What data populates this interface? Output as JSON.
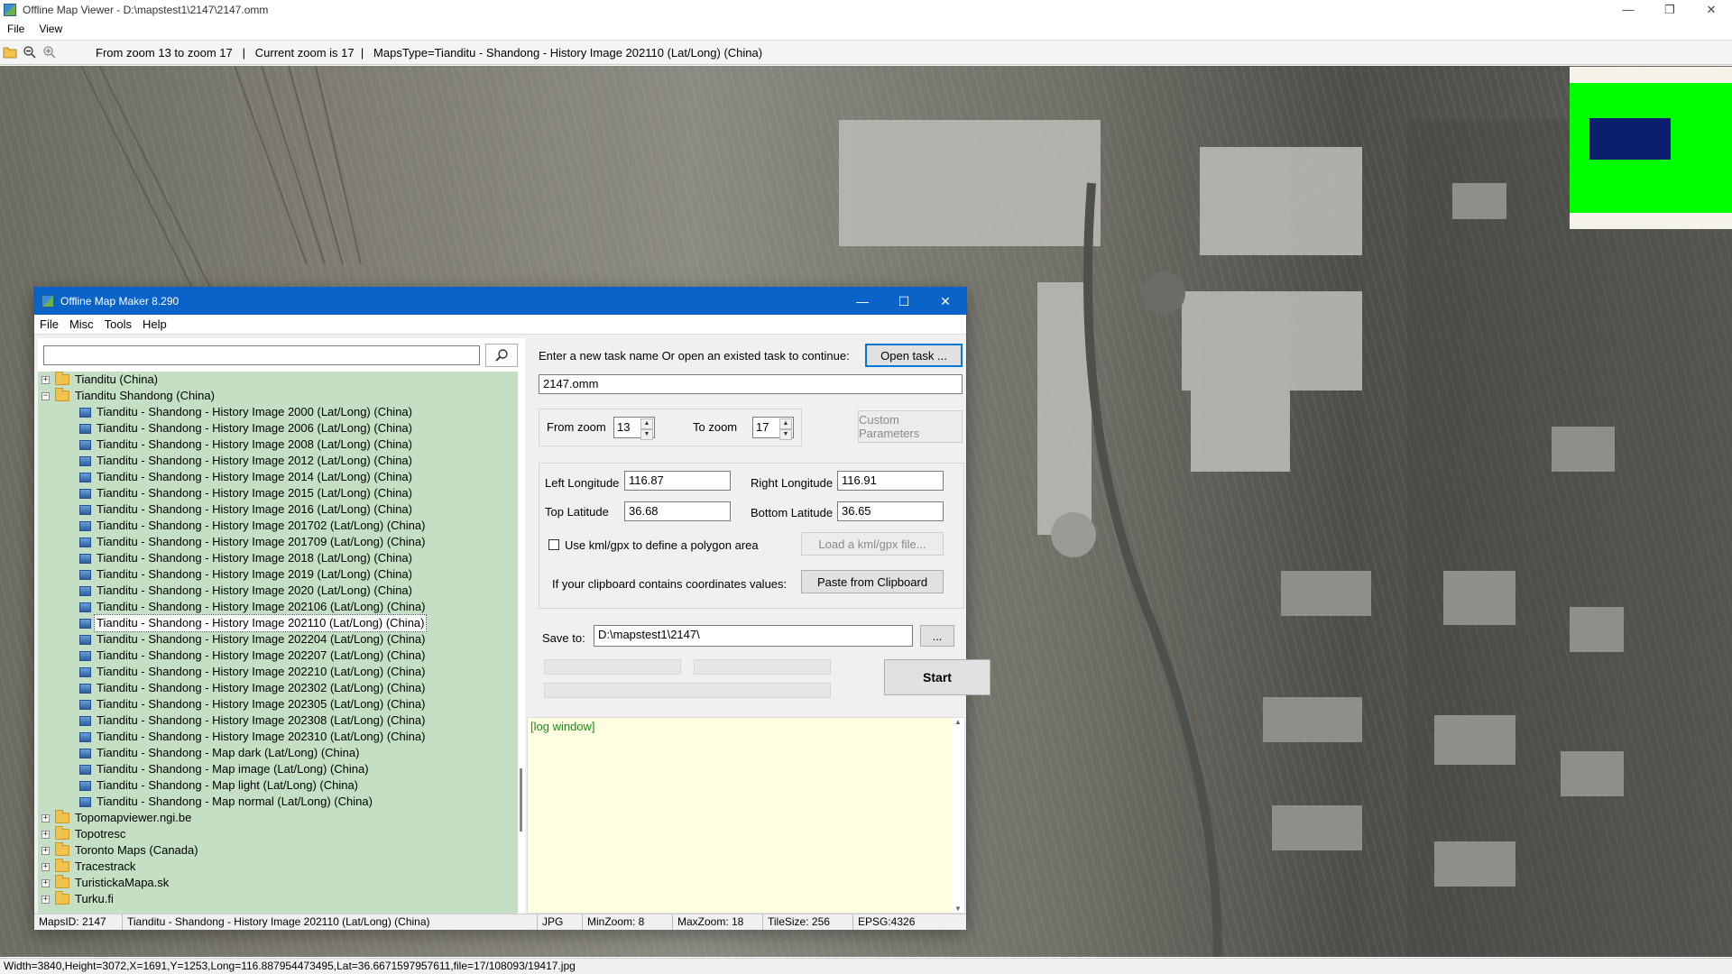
{
  "viewer": {
    "title": "Offline Map Viewer - D:\\mapstest1\\2147\\2147.omm",
    "menu": [
      "File",
      "View"
    ],
    "toolbar_status": "From zoom 13 to zoom 17   |   Current zoom is 17  |   MapsType=Tianditu - Shandong - History Image 202110 (Lat/Long) (China)",
    "status": "Width=3840,Height=3072,X=1691,Y=1253,Long=116.887954473495,Lat=36.6671597957611,file=17/108093/19417.jpg",
    "controls": {
      "minimize": "—",
      "maximize": "❐",
      "close": "✕"
    },
    "icons": {
      "open": "folder-open-icon",
      "zoom_out": "zoom-out-icon",
      "zoom_in": "zoom-in-icon"
    },
    "minimap_colors": {
      "background": "#00ff00",
      "viewport": "#0a1f6e"
    }
  },
  "dialog": {
    "title": "Offline Map Maker 8.290",
    "menu": [
      "File",
      "Misc",
      "Tools",
      "Help"
    ],
    "controls": {
      "minimize": "—",
      "maximize": "☐",
      "close": "✕"
    },
    "search": {
      "value": "",
      "placeholder": ""
    },
    "tree": [
      {
        "level": 0,
        "type": "folder",
        "expanded": false,
        "label": "Tianditu (China)"
      },
      {
        "level": 0,
        "type": "folder",
        "expanded": true,
        "label": "Tianditu Shandong (China)"
      },
      {
        "level": 1,
        "type": "map",
        "label": "Tianditu - Shandong - History Image 2000 (Lat/Long) (China)"
      },
      {
        "level": 1,
        "type": "map",
        "label": "Tianditu - Shandong - History Image 2006 (Lat/Long) (China)"
      },
      {
        "level": 1,
        "type": "map",
        "label": "Tianditu - Shandong - History Image 2008 (Lat/Long) (China)"
      },
      {
        "level": 1,
        "type": "map",
        "label": "Tianditu - Shandong - History Image 2012 (Lat/Long) (China)"
      },
      {
        "level": 1,
        "type": "map",
        "label": "Tianditu - Shandong - History Image 2014 (Lat/Long) (China)"
      },
      {
        "level": 1,
        "type": "map",
        "label": "Tianditu - Shandong - History Image 2015 (Lat/Long) (China)"
      },
      {
        "level": 1,
        "type": "map",
        "label": "Tianditu - Shandong - History Image 2016 (Lat/Long) (China)"
      },
      {
        "level": 1,
        "type": "map",
        "label": "Tianditu - Shandong - History Image 201702 (Lat/Long) (China)"
      },
      {
        "level": 1,
        "type": "map",
        "label": "Tianditu - Shandong - History Image 201709 (Lat/Long) (China)"
      },
      {
        "level": 1,
        "type": "map",
        "label": "Tianditu - Shandong - History Image 2018 (Lat/Long) (China)"
      },
      {
        "level": 1,
        "type": "map",
        "label": "Tianditu - Shandong - History Image 2019 (Lat/Long) (China)"
      },
      {
        "level": 1,
        "type": "map",
        "label": "Tianditu - Shandong - History Image 2020 (Lat/Long) (China)"
      },
      {
        "level": 1,
        "type": "map",
        "label": "Tianditu - Shandong - History Image 202106 (Lat/Long) (China)"
      },
      {
        "level": 1,
        "type": "map",
        "label": "Tianditu - Shandong - History Image 202110 (Lat/Long) (China)",
        "selected": true
      },
      {
        "level": 1,
        "type": "map",
        "label": "Tianditu - Shandong - History Image 202204 (Lat/Long) (China)"
      },
      {
        "level": 1,
        "type": "map",
        "label": "Tianditu - Shandong - History Image 202207 (Lat/Long) (China)"
      },
      {
        "level": 1,
        "type": "map",
        "label": "Tianditu - Shandong - History Image 202210 (Lat/Long) (China)"
      },
      {
        "level": 1,
        "type": "map",
        "label": "Tianditu - Shandong - History Image 202302 (Lat/Long) (China)"
      },
      {
        "level": 1,
        "type": "map",
        "label": "Tianditu - Shandong - History Image 202305 (Lat/Long) (China)"
      },
      {
        "level": 1,
        "type": "map",
        "label": "Tianditu - Shandong - History Image 202308 (Lat/Long) (China)"
      },
      {
        "level": 1,
        "type": "map",
        "label": "Tianditu - Shandong - History Image 202310 (Lat/Long) (China)"
      },
      {
        "level": 1,
        "type": "map",
        "label": "Tianditu - Shandong - Map dark (Lat/Long) (China)"
      },
      {
        "level": 1,
        "type": "map",
        "label": "Tianditu - Shandong - Map image (Lat/Long) (China)"
      },
      {
        "level": 1,
        "type": "map",
        "label": "Tianditu - Shandong - Map light (Lat/Long) (China)"
      },
      {
        "level": 1,
        "type": "map",
        "label": "Tianditu - Shandong - Map normal (Lat/Long) (China)"
      },
      {
        "level": 0,
        "type": "folder",
        "expanded": false,
        "label": "Topomapviewer.ngi.be"
      },
      {
        "level": 0,
        "type": "folder",
        "expanded": false,
        "label": "Topotresc"
      },
      {
        "level": 0,
        "type": "folder",
        "expanded": false,
        "label": "Toronto Maps (Canada)"
      },
      {
        "level": 0,
        "type": "folder",
        "expanded": false,
        "label": "Tracestrack"
      },
      {
        "level": 0,
        "type": "folder",
        "expanded": false,
        "label": "TuristickaMapa.sk"
      },
      {
        "level": 0,
        "type": "folder",
        "expanded": false,
        "label": "Turku.fi"
      }
    ],
    "task": {
      "prompt": "Enter a new task name Or open an existed task to continue:",
      "open_button": "Open task ...",
      "name": "2147.omm"
    },
    "zoom": {
      "from_label": "From zoom",
      "from_value": "13",
      "to_label": "To zoom",
      "to_value": "17",
      "custom_button": "Custom Parameters"
    },
    "coords": {
      "left_lon_label": "Left Longitude",
      "left_lon": "116.87",
      "right_lon_label": "Right Longitude",
      "right_lon": "116.91",
      "top_lat_label": "Top Latitude",
      "top_lat": "36.68",
      "bottom_lat_label": "Bottom Latitude",
      "bottom_lat": "36.65",
      "kml_label": "Use kml/gpx to define a polygon area",
      "kml_checked": false,
      "kml_button": "Load a kml/gpx file...",
      "clipboard_label": "If your clipboard contains coordinates values:",
      "clipboard_button": "Paste from Clipboard"
    },
    "save": {
      "label": "Save to:",
      "path": "D:\\mapstest1\\2147\\",
      "browse_button": "..."
    },
    "start_button": "Start",
    "log": "[log window]",
    "status": {
      "maps_id": "MapsID: 2147",
      "maps_name": "Tianditu - Shandong - History Image 202110 (Lat/Long) (China)",
      "format": "JPG",
      "min_zoom": "MinZoom: 8",
      "max_zoom": "MaxZoom: 18",
      "tile_size": "TileSize: 256",
      "epsg": "EPSG:4326"
    }
  }
}
